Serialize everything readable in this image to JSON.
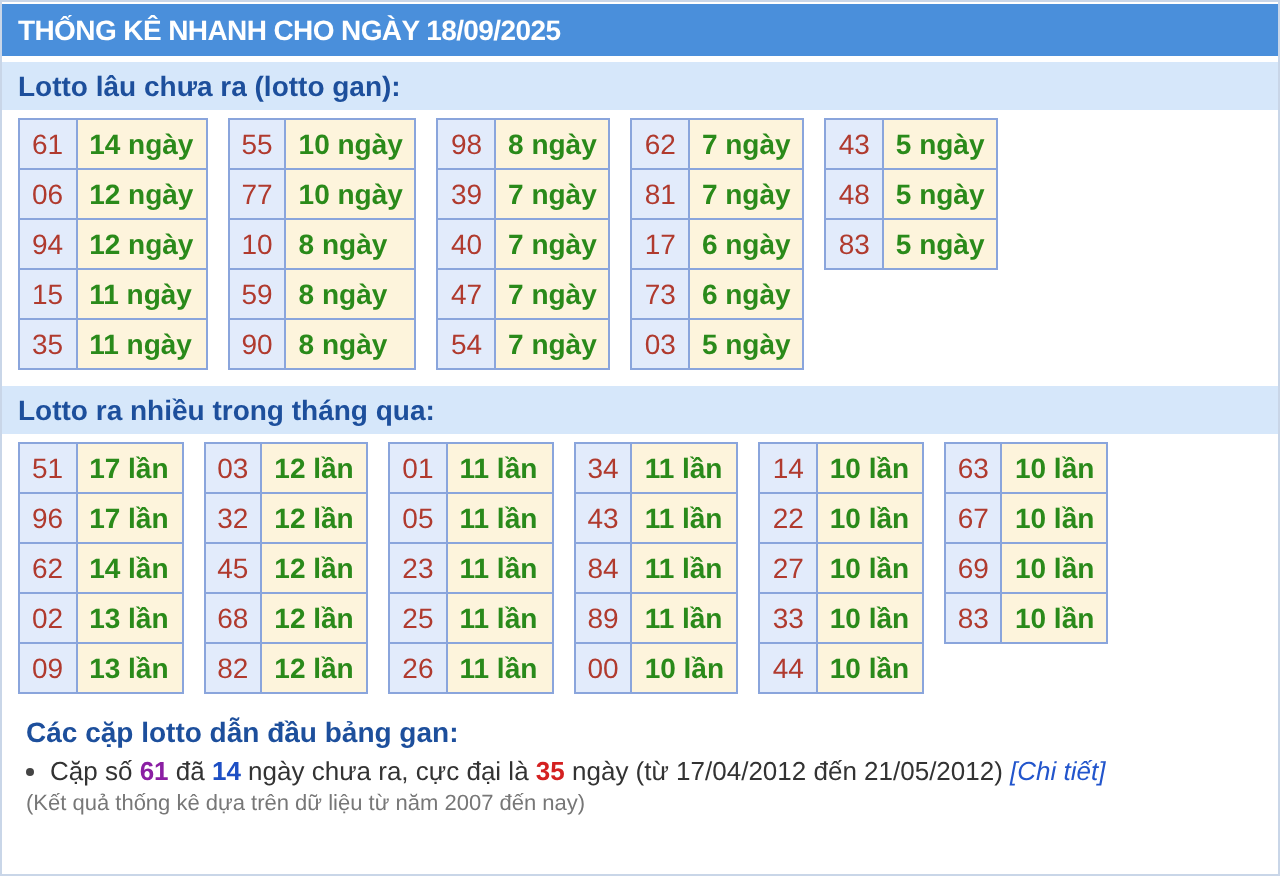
{
  "header": {
    "title": "THỐNG KÊ NHANH CHO NGÀY 18/09/2025"
  },
  "sections": [
    {
      "title": "Lotto lâu chưa ra (lotto gan):",
      "columns": [
        [
          {
            "number": "61",
            "count": "14 ngày"
          },
          {
            "number": "06",
            "count": "12 ngày"
          },
          {
            "number": "94",
            "count": "12 ngày"
          },
          {
            "number": "15",
            "count": "11 ngày"
          },
          {
            "number": "35",
            "count": "11 ngày"
          }
        ],
        [
          {
            "number": "55",
            "count": "10 ngày"
          },
          {
            "number": "77",
            "count": "10 ngày"
          },
          {
            "number": "10",
            "count": "8 ngày"
          },
          {
            "number": "59",
            "count": "8 ngày"
          },
          {
            "number": "90",
            "count": "8 ngày"
          }
        ],
        [
          {
            "number": "98",
            "count": "8 ngày"
          },
          {
            "number": "39",
            "count": "7 ngày"
          },
          {
            "number": "40",
            "count": "7 ngày"
          },
          {
            "number": "47",
            "count": "7 ngày"
          },
          {
            "number": "54",
            "count": "7 ngày"
          }
        ],
        [
          {
            "number": "62",
            "count": "7 ngày"
          },
          {
            "number": "81",
            "count": "7 ngày"
          },
          {
            "number": "17",
            "count": "6 ngày"
          },
          {
            "number": "73",
            "count": "6 ngày"
          },
          {
            "number": "03",
            "count": "5 ngày"
          }
        ],
        [
          {
            "number": "43",
            "count": "5 ngày"
          },
          {
            "number": "48",
            "count": "5 ngày"
          },
          {
            "number": "83",
            "count": "5 ngày"
          }
        ]
      ]
    },
    {
      "title": "Lotto ra nhiều trong tháng qua:",
      "columns": [
        [
          {
            "number": "51",
            "count": "17 lần"
          },
          {
            "number": "96",
            "count": "17 lần"
          },
          {
            "number": "62",
            "count": "14 lần"
          },
          {
            "number": "02",
            "count": "13 lần"
          },
          {
            "number": "09",
            "count": "13 lần"
          }
        ],
        [
          {
            "number": "03",
            "count": "12 lần"
          },
          {
            "number": "32",
            "count": "12 lần"
          },
          {
            "number": "45",
            "count": "12 lần"
          },
          {
            "number": "68",
            "count": "12 lần"
          },
          {
            "number": "82",
            "count": "12 lần"
          }
        ],
        [
          {
            "number": "01",
            "count": "11 lần"
          },
          {
            "number": "05",
            "count": "11 lần"
          },
          {
            "number": "23",
            "count": "11 lần"
          },
          {
            "number": "25",
            "count": "11 lần"
          },
          {
            "number": "26",
            "count": "11 lần"
          }
        ],
        [
          {
            "number": "34",
            "count": "11 lần"
          },
          {
            "number": "43",
            "count": "11 lần"
          },
          {
            "number": "84",
            "count": "11 lần"
          },
          {
            "number": "89",
            "count": "11 lần"
          },
          {
            "number": "00",
            "count": "10 lần"
          }
        ],
        [
          {
            "number": "14",
            "count": "10 lần"
          },
          {
            "number": "22",
            "count": "10 lần"
          },
          {
            "number": "27",
            "count": "10 lần"
          },
          {
            "number": "33",
            "count": "10 lần"
          },
          {
            "number": "44",
            "count": "10 lần"
          }
        ],
        [
          {
            "number": "63",
            "count": "10 lần"
          },
          {
            "number": "67",
            "count": "10 lần"
          },
          {
            "number": "69",
            "count": "10 lần"
          },
          {
            "number": "83",
            "count": "10 lần"
          }
        ]
      ]
    }
  ],
  "summary": {
    "title": "Các cặp lotto dẫn đầu bảng gan:",
    "items": [
      [
        {
          "kind": "plain",
          "text": "Cặp số "
        },
        {
          "kind": "pair",
          "text": "61"
        },
        {
          "kind": "plain",
          "text": " đã "
        },
        {
          "kind": "days",
          "text": "14"
        },
        {
          "kind": "plain",
          "text": " ngày chưa ra, cực đại là "
        },
        {
          "kind": "max",
          "text": "35"
        },
        {
          "kind": "plain",
          "text": " ngày (từ 17/04/2012 đến 21/05/2012) "
        },
        {
          "kind": "link",
          "text": "[Chi tiết]"
        }
      ]
    ],
    "note": "(Kết quả thống kê dựa trên dữ liệu từ năm 2007 đến nay)"
  }
}
